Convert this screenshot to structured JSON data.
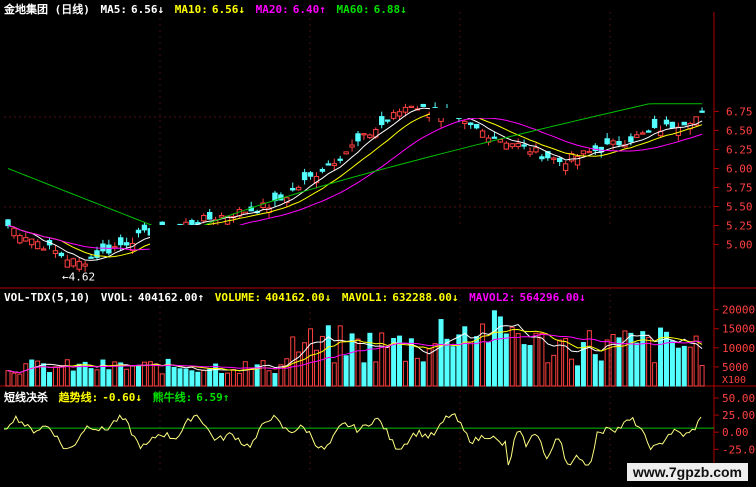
{
  "price_header": {
    "stock_name": "金地集团 (日线)",
    "ma5_label": "MA5:",
    "ma5_value": "6.56↓",
    "ma10_label": "MA10:",
    "ma10_value": "6.56↓",
    "ma20_label": "MA20:",
    "ma20_value": "6.40↑",
    "ma60_label": "MA60:",
    "ma60_value": "6.88↓"
  },
  "volume_header": {
    "indicator": "VOL-TDX(5,10)",
    "vvol_label": "VVOL:",
    "vvol_value": "404162.00↑",
    "volume_label": "VOLUME:",
    "volume_value": "404162.00↓",
    "mavol1_label": "MAVOL1:",
    "mavol1_value": "632288.00↓",
    "mavol2_label": "MAVOL2:",
    "mavol2_value": "564296.00↓"
  },
  "osc_header": {
    "title": "短线决杀",
    "trend_label": "趋势线:",
    "trend_value": "-0.60↓",
    "bull_label": "熊牛线:",
    "bull_value": "6.59↑"
  },
  "low_annotation": "←4.62",
  "price_ticks": [
    "6.75",
    "6.50",
    "6.25",
    "6.00",
    "5.75",
    "5.50",
    "5.25",
    "5.00"
  ],
  "volume_ticks": [
    "20000",
    "15000",
    "10000",
    "5000"
  ],
  "volume_unit": "X100",
  "osc_ticks": [
    "50.00",
    "25.00",
    "0.00",
    "-25.00"
  ],
  "watermark": "www.7gpzb.com",
  "colors": {
    "up": "#ff4040",
    "down": "#54ffff",
    "ma5": "#ffffff",
    "ma10": "#ffff00",
    "ma20": "#ff00ff",
    "ma60": "#00c000",
    "axis": "#b00000",
    "osc": "#ffff80",
    "osc_zero": "#00c000"
  },
  "chart_data": {
    "type": "candlestick",
    "price_range": [
      4.6,
      6.9
    ],
    "volume_range": [
      0,
      22000
    ],
    "osc_range": [
      -50,
      50
    ]
  }
}
